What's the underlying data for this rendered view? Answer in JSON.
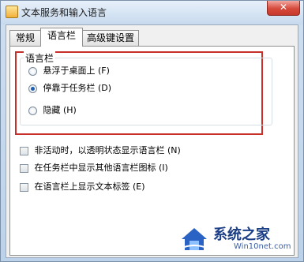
{
  "window": {
    "title": "文本服务和输入语言",
    "close": "✕"
  },
  "tabs": [
    {
      "label": "常规",
      "active": false
    },
    {
      "label": "语言栏",
      "active": true
    },
    {
      "label": "高级键设置",
      "active": false
    }
  ],
  "language_bar_group": {
    "legend": "语言栏",
    "options": [
      {
        "label": "悬浮于桌面上 (F)",
        "selected": false
      },
      {
        "label": "停靠于任务栏 (D)",
        "selected": true
      },
      {
        "label": "隐藏 (H)",
        "selected": false
      }
    ]
  },
  "checkboxes": [
    {
      "label": "非活动时，以透明状态显示语言栏 (N)",
      "checked": false
    },
    {
      "label": "在任务栏中显示其他语言栏图标 (I)",
      "checked": false
    },
    {
      "label": "在语言栏上显示文本标签 (E)",
      "checked": false
    }
  ],
  "watermark": {
    "brand": "系统之家",
    "site": "Win10net.com"
  }
}
